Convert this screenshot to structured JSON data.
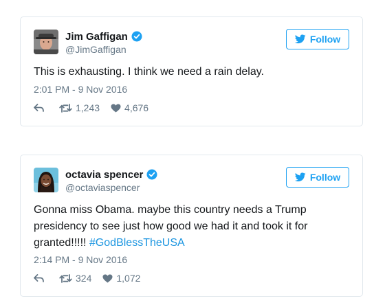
{
  "tweets": [
    {
      "author": {
        "display_name": "Jim Gaffigan",
        "handle": "@JimGaffigan",
        "verified": true
      },
      "follow_label": "Follow",
      "text": "This is exhausting. I think we need a rain delay.",
      "timestamp": "2:01 PM - 9 Nov 2016",
      "retweets": "1,243",
      "likes": "4,676"
    },
    {
      "author": {
        "display_name": "octavia spencer",
        "handle": "@octaviaspencer",
        "verified": true
      },
      "follow_label": "Follow",
      "text_line1": "Gonna miss Obama. maybe this country needs a Trump",
      "text_line2": "presidency to see just how good we had it and took it for",
      "text_line3_prefix": "granted!!!!! ",
      "hashtag": "#GodBlessTheUSA",
      "timestamp": "2:14 PM - 9 Nov 2016",
      "retweets": "324",
      "likes": "1,072"
    }
  ],
  "colors": {
    "accent": "#1da1f2",
    "hashtag": "#1b95e0",
    "muted": "#657786",
    "border": "#e1e8ed",
    "text": "#14171a"
  },
  "icons": {
    "verified": "verified-badge-icon",
    "follow": "twitter-bird-icon",
    "reply": "reply-arrow-icon",
    "retweet": "retweet-icon",
    "like": "heart-icon"
  }
}
